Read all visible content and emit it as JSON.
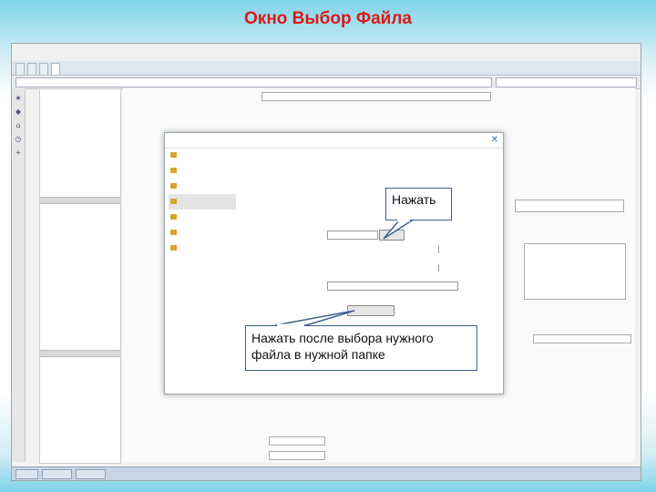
{
  "slide": {
    "title": "Окно Выбор Файла"
  },
  "callouts": {
    "press": "Нажать",
    "press_after": "Нажать после выбора нужного файла в нужной папке"
  },
  "colors": {
    "title": "#e01818",
    "callout_border": "#3b5f8c"
  },
  "icons": [
    "close-icon",
    "folder-icon",
    "bookmark-icon",
    "home-icon",
    "plus-icon"
  ]
}
